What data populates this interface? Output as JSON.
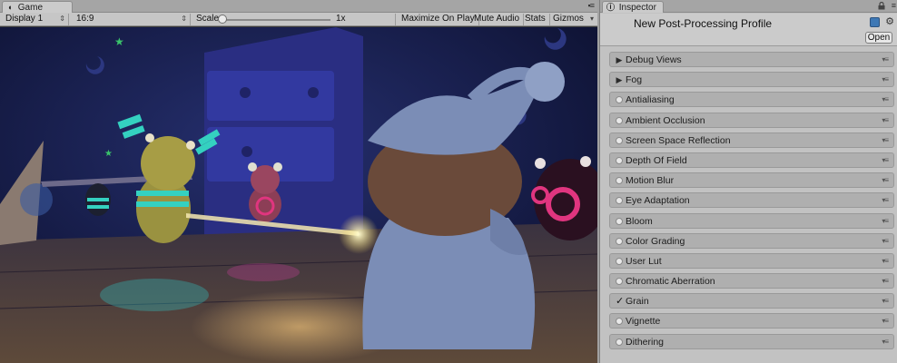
{
  "game": {
    "tab_label": "Game",
    "tab_icon": "game-controller-icon",
    "toolbar": {
      "display": "Display 1",
      "aspect": "16:9",
      "scale_label": "Scale",
      "scale_value": "1x",
      "scale_fraction": 0.0,
      "maximize_on_play": "Maximize On Play",
      "mute_audio": "Mute Audio",
      "stats": "Stats",
      "gizmos": "Gizmos"
    }
  },
  "inspector": {
    "tab_label": "Inspector",
    "tab_icon": "info-icon",
    "title": "New Post-Processing Profile",
    "open_label": "Open",
    "effects": [
      {
        "label": "Debug Views",
        "state": "arrow"
      },
      {
        "label": "Fog",
        "state": "arrow"
      },
      {
        "label": "Antialiasing",
        "state": "off"
      },
      {
        "label": "Ambient Occlusion",
        "state": "off"
      },
      {
        "label": "Screen Space Reflection",
        "state": "off"
      },
      {
        "label": "Depth Of Field",
        "state": "off"
      },
      {
        "label": "Motion Blur",
        "state": "off"
      },
      {
        "label": "Eye Adaptation",
        "state": "off"
      },
      {
        "label": "Bloom",
        "state": "off"
      },
      {
        "label": "Color Grading",
        "state": "off"
      },
      {
        "label": "User Lut",
        "state": "off"
      },
      {
        "label": "Chromatic Aberration",
        "state": "off"
      },
      {
        "label": "Grain",
        "state": "checked"
      },
      {
        "label": "Vignette",
        "state": "off"
      },
      {
        "label": "Dithering",
        "state": "off"
      }
    ]
  },
  "colors": {
    "scene_bg": "#151a3a",
    "floor": "#4a3a35",
    "accent_cyan": "#34d1c0",
    "accent_pink": "#e0357f",
    "glow": "#fff2a0"
  }
}
